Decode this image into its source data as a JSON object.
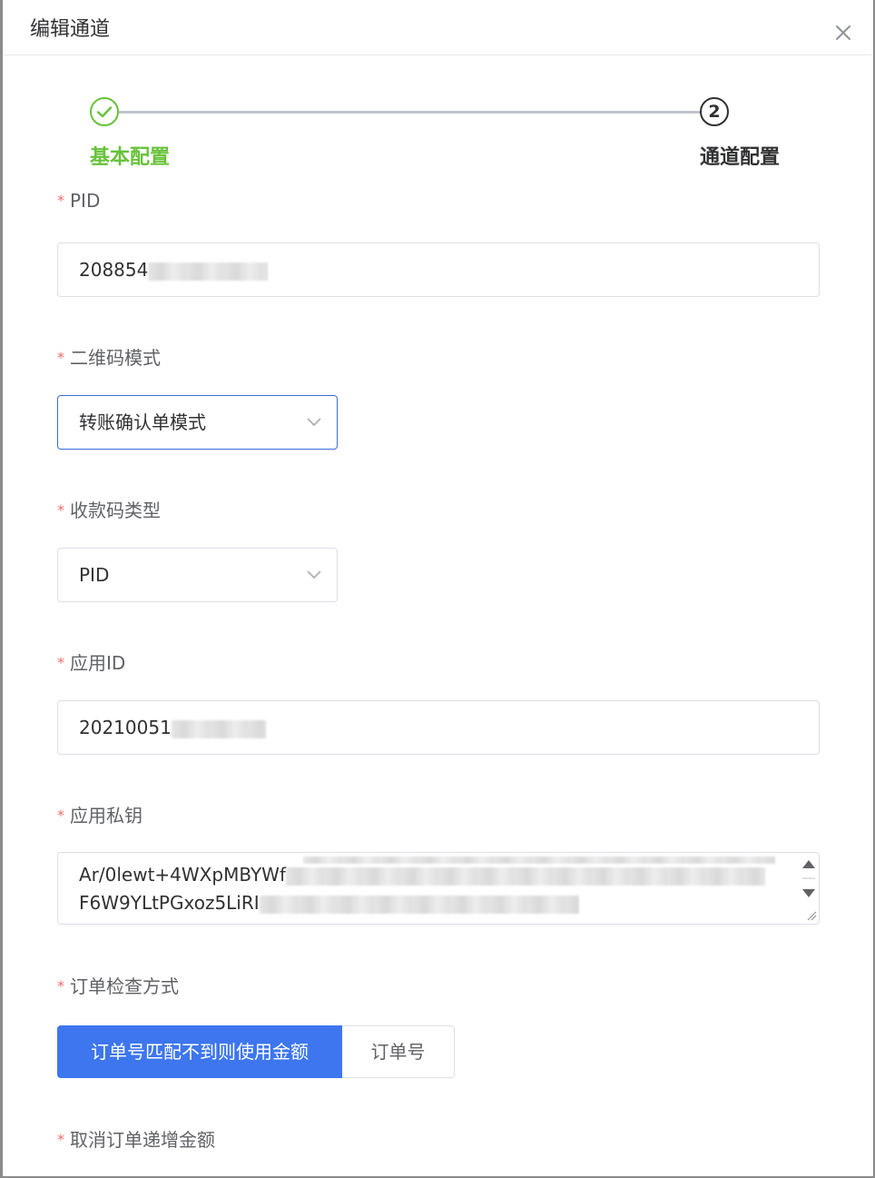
{
  "dialog": {
    "title": "编辑通道"
  },
  "steps": [
    {
      "title": "基本配置",
      "status": "finished"
    },
    {
      "number": "2",
      "title": "通道配置",
      "status": "active"
    }
  ],
  "form": {
    "pid": {
      "label": "PID",
      "value": "208854"
    },
    "qr_mode": {
      "label": "二维码模式",
      "selected": "转账确认单模式"
    },
    "receipt_type": {
      "label": "收款码类型",
      "selected": "PID"
    },
    "app_id": {
      "label": "应用ID",
      "value": "20210051"
    },
    "private_key": {
      "label": "应用私钥",
      "line1": "Ar/0lewt+4WXpMBYWf",
      "line2": "F6W9YLtPGxoz5LiRI"
    },
    "order_check": {
      "label": "订单检查方式",
      "options": [
        "订单号匹配不到则使用金额",
        "订单号"
      ],
      "selected_index": 0
    },
    "cancel_increment": {
      "label": "取消订单递增金额"
    }
  },
  "colors": {
    "success": "#67c23a",
    "primary": "#3d76ee",
    "required": "#f56c6c",
    "focus_border": "#3a6bd8"
  }
}
